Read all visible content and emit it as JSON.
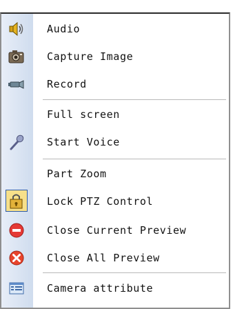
{
  "menu": {
    "items": [
      {
        "label": "Audio",
        "icon": "speaker-icon"
      },
      {
        "label": "Capture Image",
        "icon": "camera-icon"
      },
      {
        "label": "Record",
        "icon": "video-camera-icon"
      },
      {
        "label": "Full screen",
        "icon": ""
      },
      {
        "label": "Start Voice",
        "icon": "microphone-icon"
      },
      {
        "label": "Part Zoom",
        "icon": ""
      },
      {
        "label": "Lock PTZ Control",
        "icon": "lock-ptz-icon"
      },
      {
        "label": "Close Current Preview",
        "icon": "close-current-icon"
      },
      {
        "label": "Close All Preview",
        "icon": "close-all-icon"
      },
      {
        "label": "Camera attribute",
        "icon": "attribute-icon"
      }
    ]
  },
  "colors": {
    "gutter": "#d9e3f2",
    "close_current": "#e53935",
    "close_all": "#e8442c",
    "selected_bg": "#f7e08a",
    "selected_border": "#2d5aa6"
  }
}
